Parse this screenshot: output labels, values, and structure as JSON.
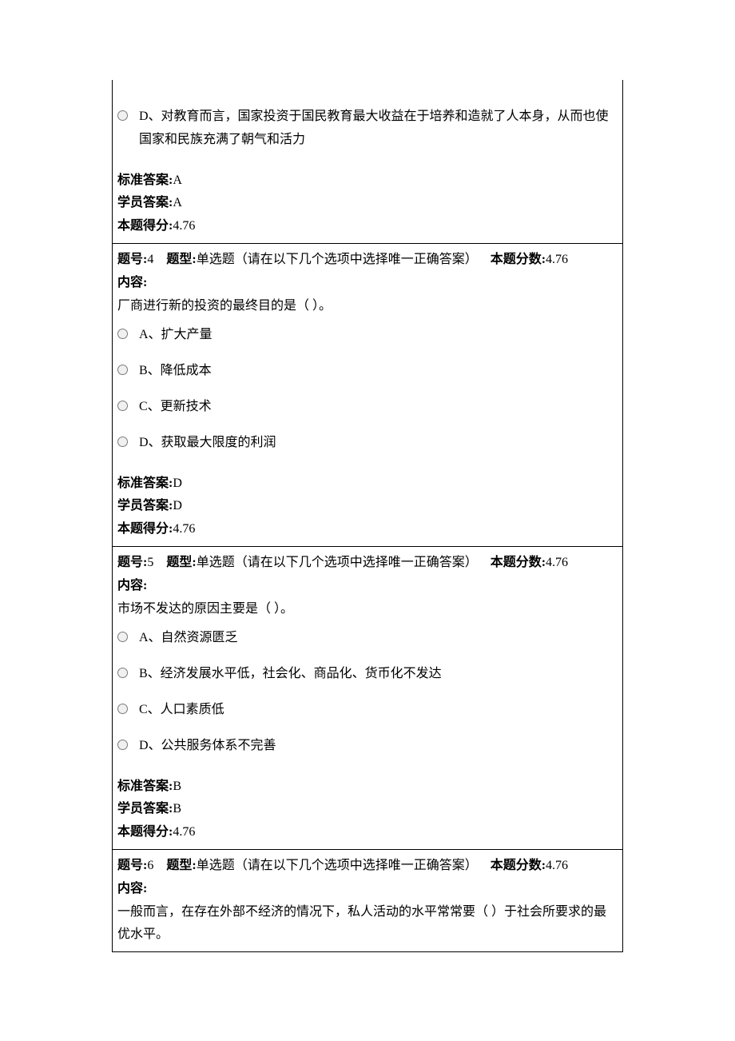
{
  "q3_tail": {
    "optD": "D、对教育而言，国家投资于国民教育最大收益在于培养和造就了人本身，从而也使国家和民族充满了朝气和活力",
    "stdLabel": "标准答案:",
    "stdVal": "A",
    "stuLabel": "学员答案:",
    "stuVal": "A",
    "scoreLabel": "本题得分:",
    "scoreVal": "4.76"
  },
  "q4": {
    "numLabel": "题号:",
    "numVal": "4",
    "typeLabel": "题型:",
    "typeVal": "单选题（请在以下几个选项中选择唯一正确答案）",
    "ptsLabel": "本题分数:",
    "ptsVal": "4.76",
    "contentLabel": "内容:",
    "stem": "厂商进行新的投资的最终目的是（ ）。",
    "optA": "A、扩大产量",
    "optB": "B、降低成本",
    "optC": "C、更新技术",
    "optD": "D、获取最大限度的利润",
    "stdLabel": "标准答案:",
    "stdVal": "D",
    "stuLabel": "学员答案:",
    "stuVal": "D",
    "scoreLabel": "本题得分:",
    "scoreVal": "4.76"
  },
  "q5": {
    "numLabel": "题号:",
    "numVal": "5",
    "typeLabel": "题型:",
    "typeVal": "单选题（请在以下几个选项中选择唯一正确答案）",
    "ptsLabel": "本题分数:",
    "ptsVal": "4.76",
    "contentLabel": "内容:",
    "stem": "市场不发达的原因主要是（ ）。",
    "optA": "A、自然资源匮乏",
    "optB": "B、经济发展水平低，社会化、商品化、货币化不发达",
    "optC": "C、人口素质低",
    "optD": "D、公共服务体系不完善",
    "stdLabel": "标准答案:",
    "stdVal": "B",
    "stuLabel": "学员答案:",
    "stuVal": "B",
    "scoreLabel": "本题得分:",
    "scoreVal": "4.76"
  },
  "q6": {
    "numLabel": "题号:",
    "numVal": "6",
    "typeLabel": "题型:",
    "typeVal": "单选题（请在以下几个选项中选择唯一正确答案）",
    "ptsLabel": "本题分数:",
    "ptsVal": "4.76",
    "contentLabel": "内容:",
    "stem": "一般而言，在存在外部不经济的情况下，私人活动的水平常常要（ ）于社会所要求的最优水平。"
  }
}
